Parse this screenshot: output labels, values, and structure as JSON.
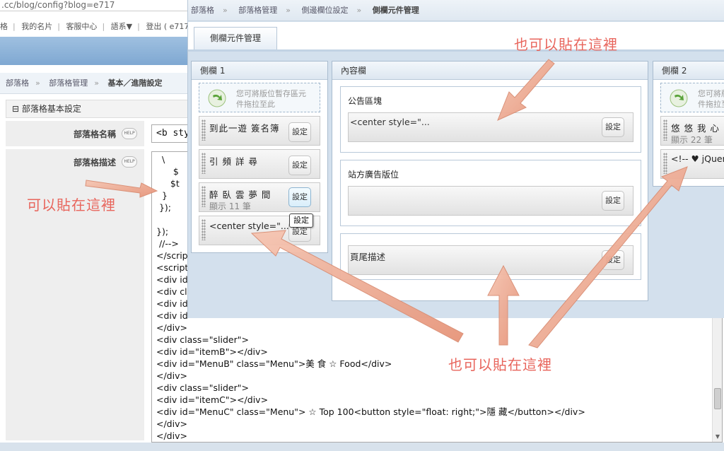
{
  "background_page": {
    "url_fragment": ".cc/blog/config?blog=e717",
    "top_links": [
      "格",
      "我的名片",
      "客服中心",
      "語系▼",
      "登出 ( e717 )"
    ],
    "breadcrumb": [
      "部落格",
      "部落格管理",
      "基本／進階設定"
    ],
    "section_title": "部落格基本設定",
    "fields": {
      "name_label": "部落格名稱",
      "name_value": "<b styl",
      "desc_label": "部落格描述",
      "help": "HELP"
    },
    "code_lines": [
      "  \\",
      "      $",
      "     $t",
      "  }",
      " });",
      "",
      "});",
      " //-->",
      "</scrip",
      "<script",
      "<div id=",
      "<div cla",
      "<div id=",
      "<div id=",
      "</div>",
      "<div class=\"slider\">",
      "<div id=\"itemB\"></div>",
      "<div id=\"MenuB\" class=\"Menu\">美 食 ☆ Food</div>",
      "</div>",
      "<div class=\"slider\">",
      "<div id=\"itemC\"></div>",
      "<div id=\"MenuC\" class=\"Menu\"> ☆ Top 100<button style=\"float: right;\">隱 藏</button></div>",
      "</div>",
      "</div>"
    ]
  },
  "overlay": {
    "breadcrumb": [
      "部落格",
      "部落格管理",
      "側邊欄位設定",
      "側欄元件管理"
    ],
    "tab": "側欄元件管理",
    "sidebar1": {
      "title": "側欄 1",
      "drop_hint": [
        "您可將版位暫存區元",
        "件拖拉至此"
      ],
      "widgets": [
        {
          "title": "到此一遊 簽名簿",
          "sub": ""
        },
        {
          "title": "引 頻 詳 尋",
          "sub": ""
        },
        {
          "title": "  醉 臥 雲 夢 間",
          "sub": "顯示 11 筆"
        },
        {
          "title": "<center style=\"...",
          "sub": ""
        }
      ],
      "tooltip": "設定"
    },
    "content": {
      "title": "內容欄",
      "blocks": [
        {
          "label": "公告區塊",
          "value": "<center style=\"..."
        },
        {
          "label": "站方廣告版位",
          "value": ""
        },
        {
          "label": "",
          "value": "頁尾描述"
        }
      ]
    },
    "sidebar2": {
      "title": "側欄 2",
      "drop_hint": [
        "您可將版",
        "件拖拉至"
      ],
      "widgets": [
        {
          "title": "悠 悠 我 心  ·",
          "sub": "顯示 22 筆"
        },
        {
          "title": "<!-- ♥ jQuer",
          "sub": ""
        }
      ]
    },
    "set_label": "設定"
  },
  "annotations": {
    "top": "也可以貼在這裡",
    "left": "可以貼在這裡",
    "bottom": "也可以貼在這裡"
  },
  "colors": {
    "annotation": "#e8655c",
    "arrow": "#e9a58d",
    "overlay_bg": "#d3e0ed"
  }
}
